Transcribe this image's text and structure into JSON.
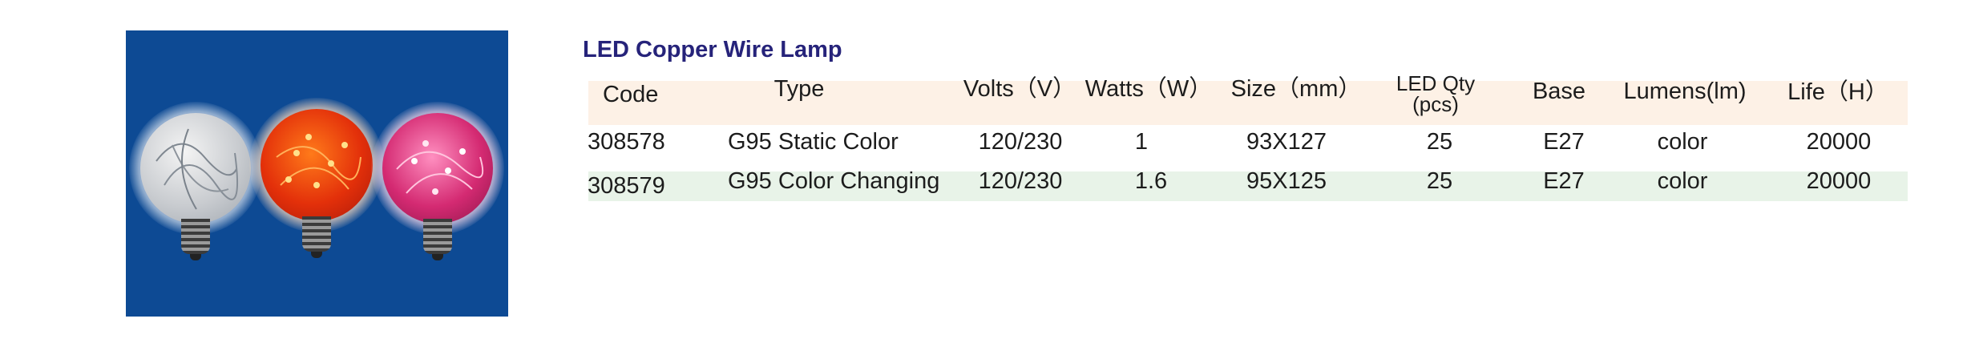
{
  "title": "LED Copper Wire Lamp",
  "photo": {
    "background": "#0d4a94",
    "bulbs": [
      "clear-globe-bulb",
      "orange-globe-bulb",
      "pink-globe-bulb"
    ]
  },
  "table": {
    "headers": {
      "code": "Code",
      "type": "Type",
      "volts": "Volts（V）",
      "watts": "Watts（W）",
      "size": "Size（mm）",
      "led_qty_line1": "LED Qty",
      "led_qty_line2": "(pcs)",
      "base": "Base",
      "lumens": "Lumens(lm)",
      "life": "Life（H）"
    },
    "rows": [
      {
        "code": "308578",
        "type": "G95 Static Color",
        "volts": "120/230",
        "watts": "1",
        "size": "93X127",
        "led_qty": "25",
        "base": "E27",
        "lumens": "color",
        "life": "20000"
      },
      {
        "code": "308579",
        "type": "G95 Color Changing",
        "volts": "120/230",
        "watts": "1.6",
        "size": "95X125",
        "led_qty": "25",
        "base": "E27",
        "lumens": "color",
        "life": "20000"
      }
    ]
  },
  "colors": {
    "title": "#26237a",
    "header_band": "#fdf1e6",
    "row_band": "#e8f3e8"
  }
}
